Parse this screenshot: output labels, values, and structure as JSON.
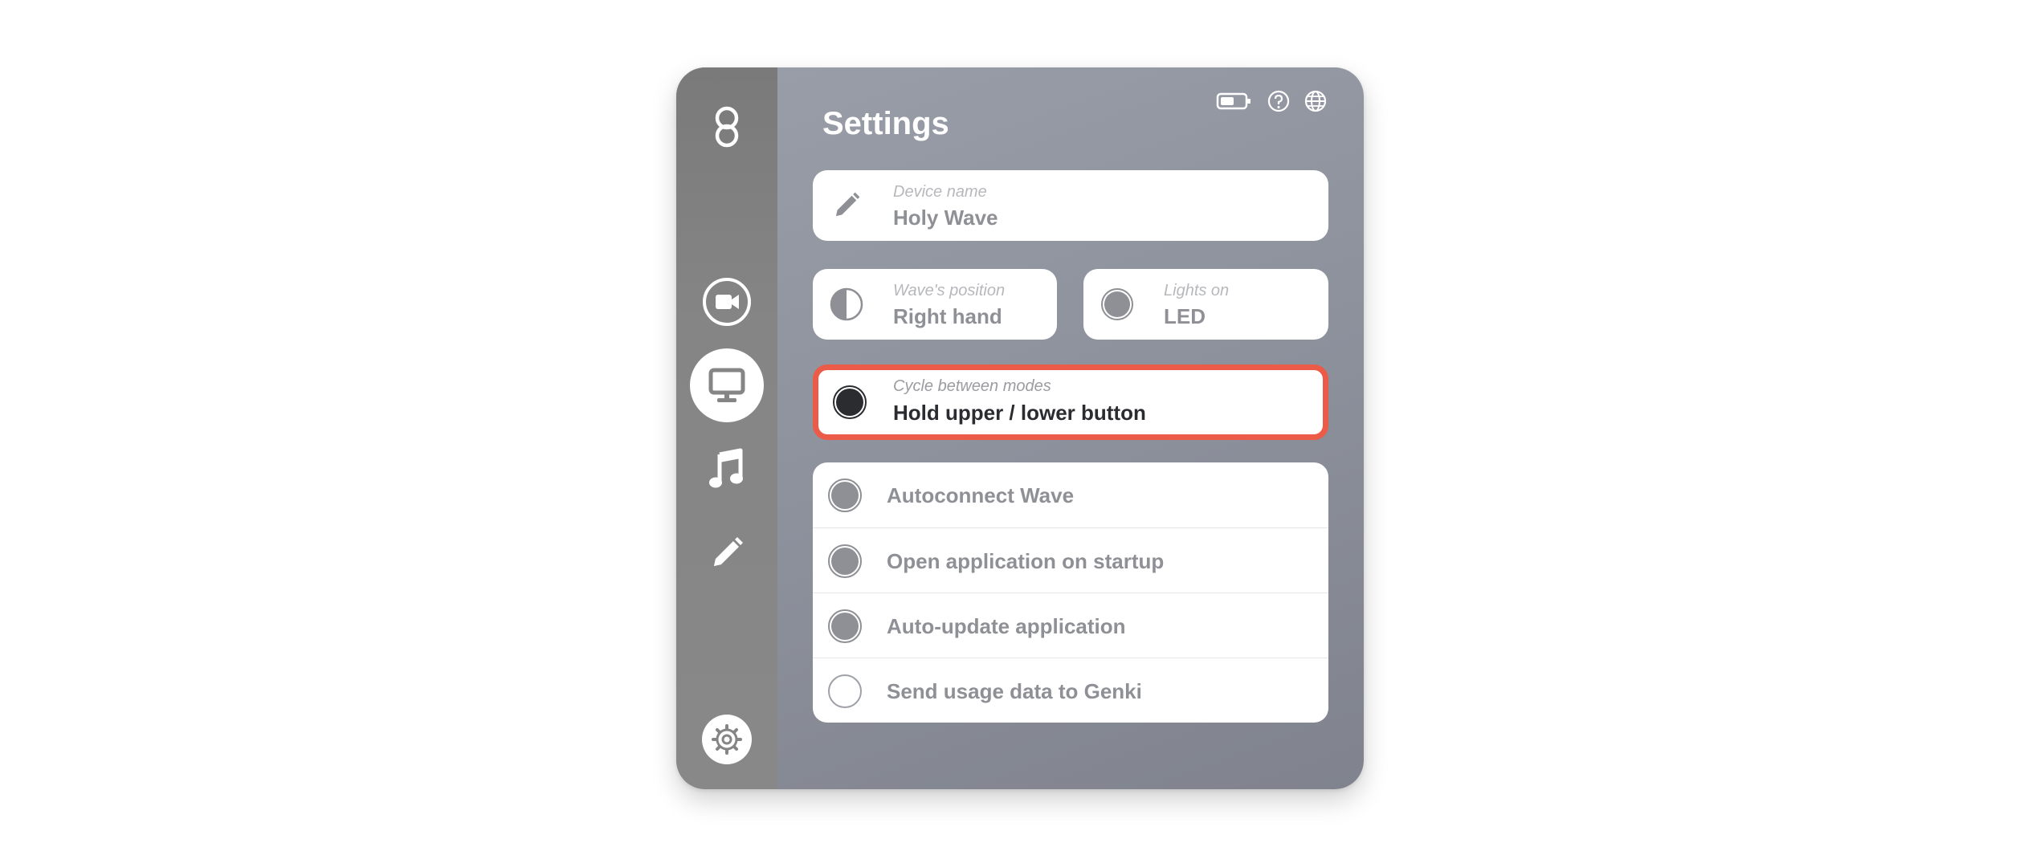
{
  "app": {
    "title": "Settings"
  },
  "sidebar": {
    "logo": "infinity-logo-icon",
    "items": [
      {
        "name": "video",
        "icon": "video-camera-icon",
        "active": false
      },
      {
        "name": "desktop",
        "icon": "monitor-icon",
        "active": true
      },
      {
        "name": "music",
        "icon": "music-note-icon",
        "active": false
      },
      {
        "name": "edit",
        "icon": "pencil-icon",
        "active": false
      }
    ],
    "bottom_icon": "gear-icon"
  },
  "header_icons": [
    "battery-icon",
    "help-icon",
    "globe-icon"
  ],
  "device": {
    "label": "Device name",
    "value": "Holy Wave",
    "icon": "pencil-icon"
  },
  "position": {
    "label": "Wave's position",
    "value": "Right hand",
    "icon": "half-circle-icon"
  },
  "lights": {
    "label": "Lights on",
    "value": "LED",
    "icon": "filled-circle-icon"
  },
  "cycle": {
    "label": "Cycle between modes",
    "value": "Hold upper / lower button",
    "icon": "dark-circle-icon",
    "highlight_color": "#ec5a48"
  },
  "options": [
    {
      "label": "Autoconnect Wave",
      "checked": true
    },
    {
      "label": "Open application on startup",
      "checked": true
    },
    {
      "label": "Auto-update application",
      "checked": true
    },
    {
      "label": "Send usage data to Genki",
      "checked": false
    }
  ],
  "colors": {
    "panel": "#8c909b",
    "sidebar": "#858585",
    "text_muted": "#8f9095",
    "text_dark": "#2b2c30",
    "highlight": "#ec5a48"
  }
}
